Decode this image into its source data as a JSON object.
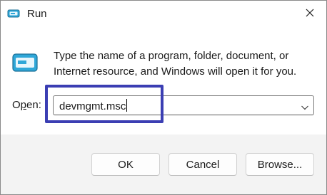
{
  "window": {
    "title": "Run",
    "close_icon": "close-icon"
  },
  "dialog": {
    "description_line1": "Type the name of a program, folder, document, or",
    "description_line2": "Internet resource, and Windows will open it for you.",
    "open_label_prefix": "O",
    "open_label_accel": "p",
    "open_label_suffix": "en:",
    "open_value": "devmgmt.msc",
    "dropdown_icon": "chevron-down-icon"
  },
  "buttons": {
    "ok": "OK",
    "cancel": "Cancel",
    "browse": "Browse..."
  },
  "colors": {
    "highlight": "#3b3eb3",
    "icon_accent": "#2fa7d8"
  }
}
